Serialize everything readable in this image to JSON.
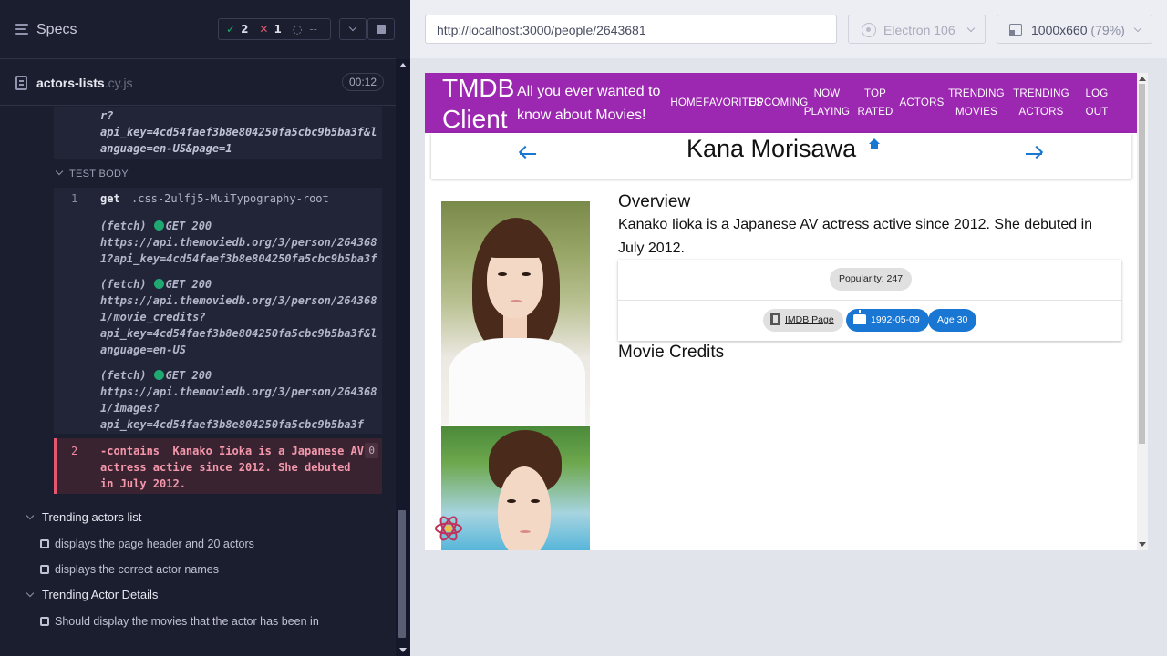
{
  "reporter": {
    "specs_label": "Specs",
    "stats": {
      "passed": "2",
      "failed": "1",
      "pending": "--"
    },
    "file": {
      "name": "actors-lists",
      "ext": ".cy.js",
      "time": "00:12"
    },
    "prev_url_fragment": "r?\napi_key=4cd54faef3b8e804250fa5cbc9b5ba3f&l\nanguage=en-US&page=1",
    "test_body_label": "TEST BODY",
    "commands": [
      {
        "num": "1",
        "name": "get",
        "arg": ".css-2ulfj5-MuiTypography-root"
      }
    ],
    "fetches": [
      {
        "tag": "(fetch)",
        "method": "GET 200",
        "url": "https://api.themoviedb.org/3/person/264368\n1?api_key=4cd54faef3b8e804250fa5cbc9b5ba3f"
      },
      {
        "tag": "(fetch)",
        "method": "GET 200",
        "url": "https://api.themoviedb.org/3/person/264368\n1/movie_credits?\napi_key=4cd54faef3b8e804250fa5cbc9b5ba3f&l\nanguage=en-US"
      },
      {
        "tag": "(fetch)",
        "method": "GET 200",
        "url": "https://api.themoviedb.org/3/person/264368\n1/images?\napi_key=4cd54faef3b8e804250fa5cbc9b5ba3f"
      }
    ],
    "failed_command": {
      "num": "2",
      "text": "-contains  Kanako Iioka is a Japanese AV\nactress active since 2012. She debuted\nin July 2012.",
      "badge": "0"
    },
    "suites": [
      {
        "title": "Trending actors list",
        "tests": [
          "displays the page header and 20 actors",
          "displays the correct actor names"
        ]
      },
      {
        "title": "Trending Actor Details",
        "tests": [
          "Should display the movies that the actor has been in"
        ]
      }
    ]
  },
  "toolbar": {
    "url": "http://localhost:3000/people/2643681",
    "browser": "Electron 106",
    "viewport": "1000x660",
    "zoom": "(79%)"
  },
  "app": {
    "title": "TMDB Client",
    "tagline": "All you ever wanted to know about Movies!",
    "nav": [
      "HOME",
      "FAVORITES",
      "UPCOMING",
      "NOW PLAYING",
      "TOP RATED",
      "ACTORS",
      "TRENDING MOVIES",
      "TRENDING ACTORS",
      "LOG OUT"
    ],
    "person_name": "Kana Morisawa",
    "overview_heading": "Overview",
    "overview_text": "Kanako Iioka is a Japanese AV actress active since 2012. She debuted in July 2012.",
    "popularity": "Popularity: 247",
    "imdb_label": "IMDB Page",
    "birthday": "1992-05-09",
    "age": "Age 30",
    "credits_heading": "Movie Credits"
  },
  "colors": {
    "header": "#9c27b0",
    "accent": "#1976d2",
    "pass": "#1fa971",
    "fail": "#e45770"
  }
}
